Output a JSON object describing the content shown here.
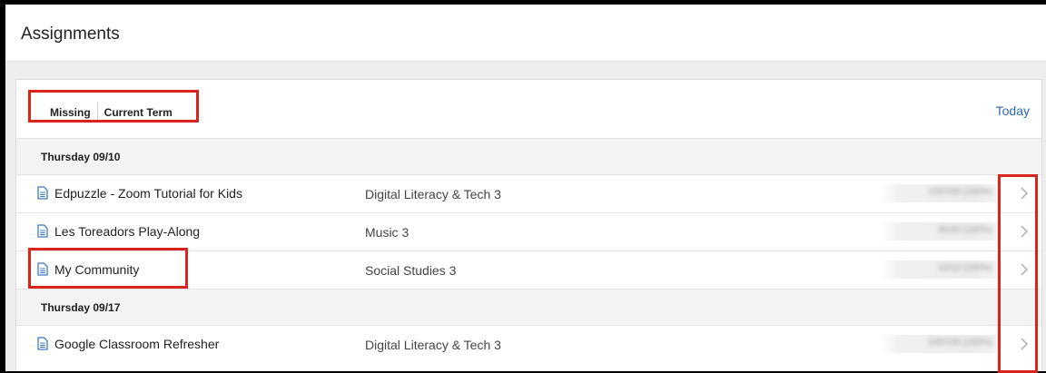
{
  "header": {
    "title": "Assignments"
  },
  "filters": {
    "missing_label": "Missing",
    "term_label": "Current Term"
  },
  "today_label": "Today",
  "groups": [
    {
      "date": "Thursday 09/10",
      "items": [
        {
          "name": "Edpuzzle - Zoom Tutorial for Kids",
          "course": "Digital Literacy & Tech 3",
          "score": "100/100 (100%)"
        },
        {
          "name": "Les Toreadors Play-Along",
          "course": "Music 3",
          "score": "40/40 (100%)"
        },
        {
          "name": "My Community",
          "course": "Social Studies 3",
          "score": "10/10 (100%)"
        }
      ]
    },
    {
      "date": "Thursday 09/17",
      "items": [
        {
          "name": "Google Classroom Refresher",
          "course": "Digital Literacy & Tech 3",
          "score": "100/100 (100%)"
        }
      ]
    }
  ],
  "icons": {
    "document": "document-icon",
    "chevron": "chevron-right-icon"
  },
  "colors": {
    "link": "#2a6ab2",
    "annotation": "#d8241d",
    "icon": "#3f7ac9"
  }
}
